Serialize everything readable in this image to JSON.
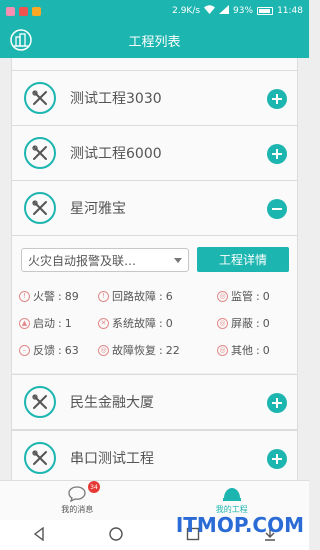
{
  "status_bar": {
    "speed": "2.9K/s",
    "battery": "93%",
    "time": "11:48",
    "notify_colors": [
      "#f48fb1",
      "#ef5350",
      "#f9a825"
    ]
  },
  "header": {
    "title": "工程列表",
    "icon": "building-icon"
  },
  "projects": [
    {
      "name": "测试工程3030",
      "expanded": false
    },
    {
      "name": "测试工程6000",
      "expanded": false
    },
    {
      "name": "星河雅宝",
      "expanded": true
    },
    {
      "name": "民生金融大厦",
      "expanded": false
    },
    {
      "name": "串口测试工程",
      "expanded": false
    }
  ],
  "detail": {
    "system_select": "火灾自动报警及联…",
    "detail_button": "工程详情",
    "stats": [
      {
        "label": "火警",
        "value": "89",
        "icon": "fire-alarm-icon"
      },
      {
        "label": "回路故障",
        "value": "6",
        "icon": "loop-fault-icon"
      },
      {
        "label": "监管",
        "value": "0",
        "icon": "supervise-icon"
      },
      {
        "label": "启动",
        "value": "1",
        "icon": "start-icon"
      },
      {
        "label": "系统故障",
        "value": "0",
        "icon": "system-fault-icon"
      },
      {
        "label": "屏蔽",
        "value": "0",
        "icon": "shield-icon"
      },
      {
        "label": "反馈",
        "value": "63",
        "icon": "feedback-icon"
      },
      {
        "label": "故障恢复",
        "value": "22",
        "icon": "fault-recover-icon"
      },
      {
        "label": "其他",
        "value": "0",
        "icon": "other-icon"
      }
    ]
  },
  "bottom_nav": {
    "messages_label": "我的消息",
    "messages_badge": "34",
    "projects_label": "我的工程"
  },
  "watermark": "ITMOP.COM",
  "colors": {
    "accent": "#1cb5b0",
    "alarm_icon": "#e38a8a",
    "badge": "#e53935"
  }
}
